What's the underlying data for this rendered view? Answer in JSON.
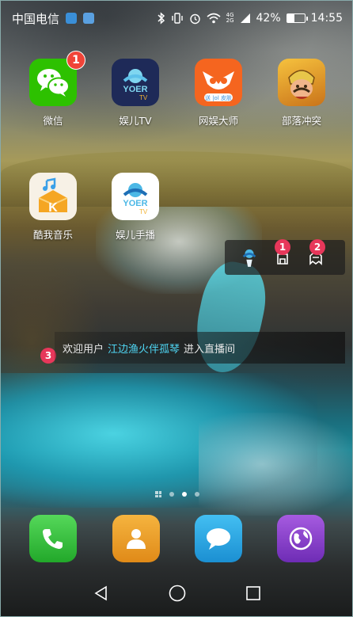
{
  "status_bar": {
    "carrier": "中国电信",
    "network_top": "4G",
    "network_bottom": "2G",
    "battery_percent": "42%",
    "battery_level": 0.42,
    "time": "14:55"
  },
  "apps": [
    {
      "label": "微信",
      "icon": "wechat-icon",
      "badge": "1",
      "color": "#2dc100"
    },
    {
      "label": "娱儿TV",
      "icon": "yuer-tv-icon",
      "color": "#1e2a58"
    },
    {
      "label": "网娱大师",
      "icon": "owl-icon",
      "color": "#f5651f"
    },
    {
      "label": "部落冲突",
      "icon": "clash-of-clans-icon",
      "color": "#d58a1e"
    },
    {
      "label": "酷我音乐",
      "icon": "kuwo-music-icon",
      "color": "#f7f1e6"
    },
    {
      "label": "娱儿手播",
      "icon": "yuer-live-icon",
      "color": "#ffffff"
    }
  ],
  "app_logo_text": {
    "yuer_tv_top": "YOER",
    "yuer_tv_bottom": "TV",
    "owl_bottom": "送 |ol 皮肤",
    "kuwo_letter": "K"
  },
  "overlay": {
    "marker_1": "1",
    "marker_2": "2"
  },
  "welcome": {
    "marker": "3",
    "prefix": "欢迎用户",
    "username": "江边渔火伴孤琴",
    "suffix": "进入直播间"
  },
  "dock": [
    {
      "icon": "phone-icon",
      "color": "#33c33a"
    },
    {
      "icon": "contacts-icon",
      "color": "#f0a02a"
    },
    {
      "icon": "messages-icon",
      "color": "#2aa8e6"
    },
    {
      "icon": "browser-icon",
      "color": "#8a3bc9"
    }
  ],
  "nav": {
    "back": "back-icon",
    "home": "home-icon",
    "recents": "recents-icon"
  },
  "colors": {
    "badge": "#f04438",
    "marker": "#e7375a",
    "username_accent": "#4fd7f5"
  }
}
